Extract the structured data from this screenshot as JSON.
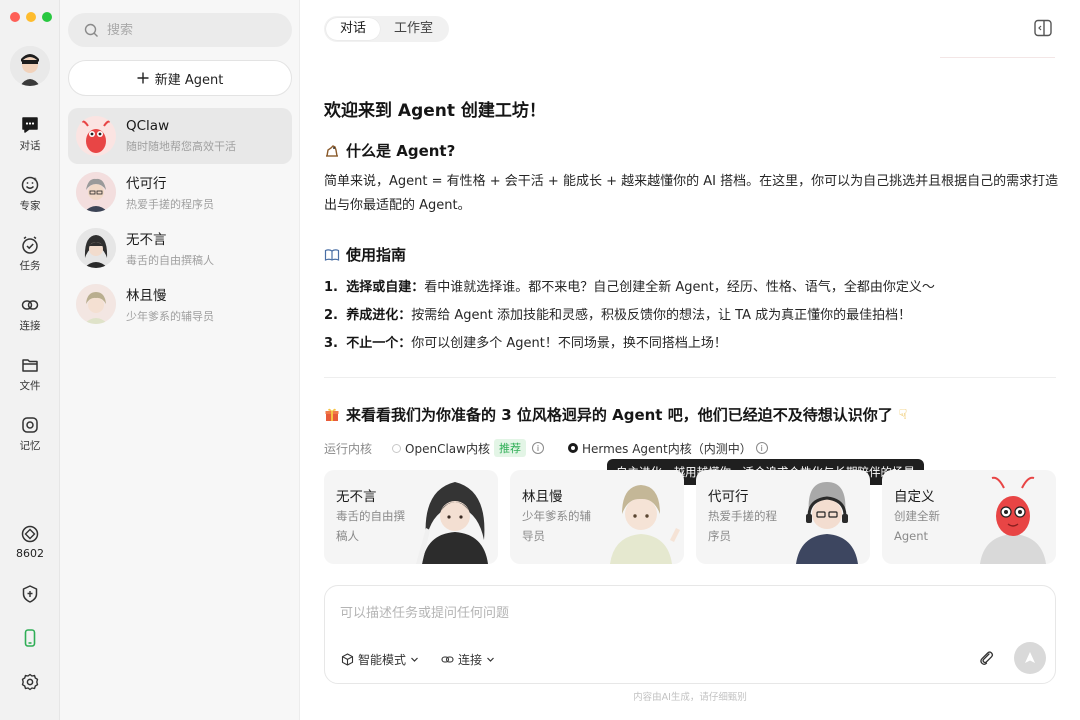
{
  "rail": {
    "items": [
      {
        "label": "对话"
      },
      {
        "label": "专家"
      },
      {
        "label": "任务"
      },
      {
        "label": "连接"
      },
      {
        "label": "文件"
      },
      {
        "label": "记忆"
      }
    ],
    "points": "8602"
  },
  "list": {
    "search_placeholder": "搜索",
    "new_agent_label": "新建 Agent",
    "conversations": [
      {
        "name": "QClaw",
        "subtitle": "随时随地帮您高效干活"
      },
      {
        "name": "代可行",
        "subtitle": "热爱手搓的程序员"
      },
      {
        "name": "无不言",
        "subtitle": "毒舌的自由撰稿人"
      },
      {
        "name": "林且慢",
        "subtitle": "少年爹系的辅导员"
      }
    ]
  },
  "main": {
    "tabs": [
      "对话",
      "工作室"
    ],
    "welcome_title": "欢迎来到 Agent 创建工坊！",
    "what_title": "什么是 Agent?",
    "what_body": "简单来说，Agent = 有性格 + 会干活 + 能成长 + 越来越懂你的 AI 搭档。在这里，你可以为自己挑选并且根据自己的需求打造出与你最适配的 Agent。",
    "guide_title": "使用指南",
    "guide_items": [
      {
        "num": "1.",
        "bold": "选择或自建：",
        "text": "看中谁就选择谁。都不来电？自己创建全新 Agent，经历、性格、语气，全都由你定义～"
      },
      {
        "num": "2.",
        "bold": "养成进化：",
        "text": "按需给 Agent 添加技能和灵感，积极反馈你的想法，让 TA 成为真正懂你的最佳拍档！"
      },
      {
        "num": "3.",
        "bold": "不止一个：",
        "text": "你可以创建多个 Agent！不同场景，换不同搭档上场！"
      }
    ],
    "pick_title": "来看看我们为你准备的 3 位风格迥异的 Agent 吧，他们已经迫不及待想认识你了",
    "kernel_label": "运行内核",
    "kernel_options": [
      {
        "label": "OpenClaw内核",
        "badge": "推荐",
        "selected": false
      },
      {
        "label": "Hermes Agent内核（内测中）",
        "selected": true
      }
    ],
    "tooltip": "自主进化、越用越懂你，适合追求个性化与长期陪伴的场景",
    "cards": [
      {
        "name": "无不言",
        "desc": "毒舌的自由撰稿人"
      },
      {
        "name": "林且慢",
        "desc": "少年爹系的辅导员"
      },
      {
        "name": "代可行",
        "desc": "热爱手搓的程序员"
      },
      {
        "name": "自定义",
        "desc": "创建全新 Agent"
      }
    ],
    "composer": {
      "placeholder": "可以描述任务或提问任何问题",
      "mode_label": "智能模式",
      "connect_label": "连接"
    },
    "footnote": "内容由AI生成，请仔细甄别"
  },
  "colors": {
    "accent_green": "#2fae56",
    "tooltip_bg": "#1f1f1f",
    "qclaw_red": "#e84545"
  }
}
